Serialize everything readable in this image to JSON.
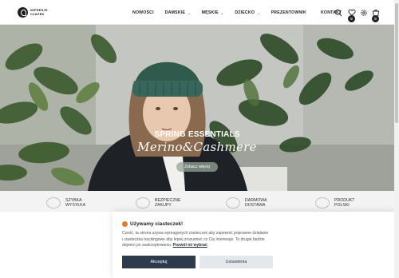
{
  "header": {
    "brand": [
      "IMPRESJE",
      "CZAPEK"
    ],
    "nav": [
      {
        "label": "NOWOŚCI",
        "dropdown": false
      },
      {
        "label": "DAMSKIE",
        "dropdown": true
      },
      {
        "label": "MĘSKIE",
        "dropdown": true
      },
      {
        "label": "DZIECKO",
        "dropdown": true
      },
      {
        "label": "PREZENTOWNIK",
        "dropdown": false
      },
      {
        "label": "KONTAKT",
        "dropdown": false
      }
    ],
    "icons": [
      "search-icon",
      "heart-icon",
      "gear-icon",
      "cart-icon"
    ],
    "wishlist_count": "0",
    "cart_count": "0"
  },
  "hero": {
    "eyebrow": "SPRING ESSENTIALS",
    "title": "Merino&Cashmere",
    "button": "Zobacz więcej"
  },
  "features": [
    {
      "label": "SZYBKA WYSYŁKA"
    },
    {
      "label": "BEZPIECZNE ZAKUPY"
    },
    {
      "label": "DARMOWA DOSTAWA"
    },
    {
      "label": "PRODUKT POLSKI"
    }
  ],
  "cookie": {
    "title": "Używamy ciasteczek!",
    "text": "Cześć, ta strona używa wymaganych ciasteczek aby zapewnić poprawne działanie i ciasteczka trackingowe aby lepiej zrozumieć co Cię interesuje. To drugie będzie dopiero po zaakceptowaniu.",
    "link": "Pozwól mi wybrać",
    "accept": "Akceptuj",
    "settings": "Ustawienia"
  },
  "colors": {
    "accent": "#2e3b4c",
    "badge": "#1f1f1f",
    "beanie": "#2f5a4c"
  }
}
